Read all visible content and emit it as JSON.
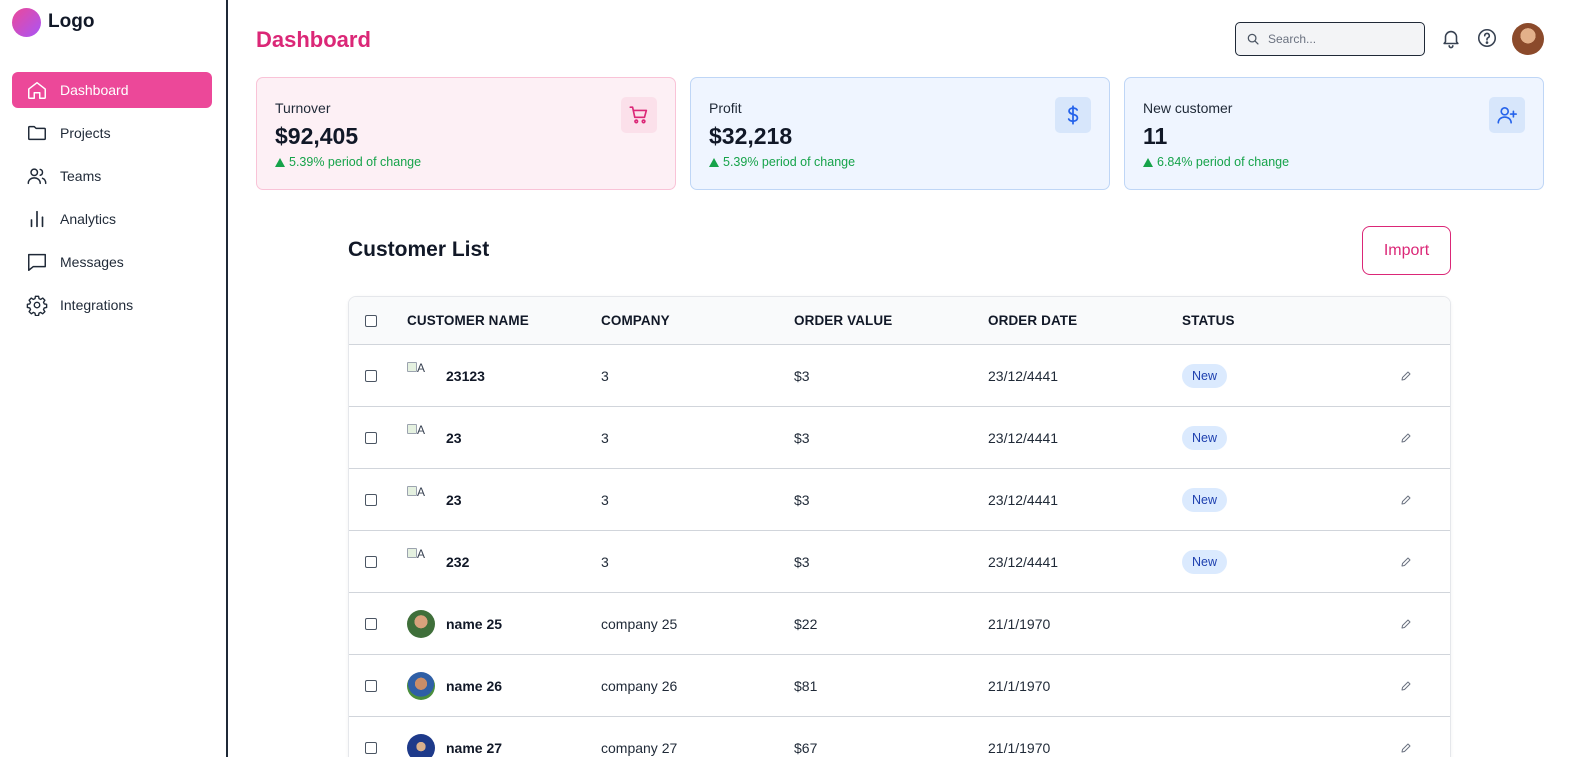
{
  "logo": {
    "text": "Logo"
  },
  "sidebar": {
    "items": [
      {
        "label": "Dashboard",
        "icon": "home-icon"
      },
      {
        "label": "Projects",
        "icon": "folder-icon"
      },
      {
        "label": "Teams",
        "icon": "users-icon"
      },
      {
        "label": "Analytics",
        "icon": "bar-chart-icon"
      },
      {
        "label": "Messages",
        "icon": "message-icon"
      },
      {
        "label": "Integrations",
        "icon": "gear-icon"
      }
    ],
    "active_index": 0
  },
  "header": {
    "title": "Dashboard",
    "search_placeholder": "Search..."
  },
  "cards": [
    {
      "label": "Turnover",
      "value": "$92,405",
      "change": "5.39% period of change",
      "icon": "cart-icon",
      "accent": "#db2777"
    },
    {
      "label": "Profit",
      "value": "$32,218",
      "change": "5.39% period of change",
      "icon": "dollar-icon",
      "accent": "#2563eb"
    },
    {
      "label": "New customer",
      "value": "11",
      "change": "6.84% period of change",
      "icon": "user-plus-icon",
      "accent": "#2563eb"
    }
  ],
  "customers": {
    "title": "Customer List",
    "import_label": "Import",
    "columns": [
      "CUSTOMER NAME",
      "COMPANY",
      "ORDER VALUE",
      "ORDER DATE",
      "STATUS"
    ],
    "rows": [
      {
        "avatar_alt": "A",
        "name": "23123",
        "company": "3",
        "order_value": "$3",
        "order_date": "23/12/4441",
        "status": "New"
      },
      {
        "avatar_alt": "A",
        "name": "23",
        "company": "3",
        "order_value": "$3",
        "order_date": "23/12/4441",
        "status": "New"
      },
      {
        "avatar_alt": "A",
        "name": "23",
        "company": "3",
        "order_value": "$3",
        "order_date": "23/12/4441",
        "status": "New"
      },
      {
        "avatar_alt": "A",
        "name": "232",
        "company": "3",
        "order_value": "$3",
        "order_date": "23/12/4441",
        "status": "New"
      },
      {
        "name": "name 25",
        "company": "company 25",
        "order_value": "$22",
        "order_date": "21/1/1970",
        "status": ""
      },
      {
        "name": "name 26",
        "company": "company 26",
        "order_value": "$81",
        "order_date": "21/1/1970",
        "status": ""
      },
      {
        "name": "name 27",
        "company": "company 27",
        "order_value": "$67",
        "order_date": "21/1/1970",
        "status": ""
      }
    ]
  },
  "colors": {
    "brand": "#ec4899",
    "title": "#db2777",
    "success": "#16a34a",
    "badge_bg": "#dbeafe"
  }
}
